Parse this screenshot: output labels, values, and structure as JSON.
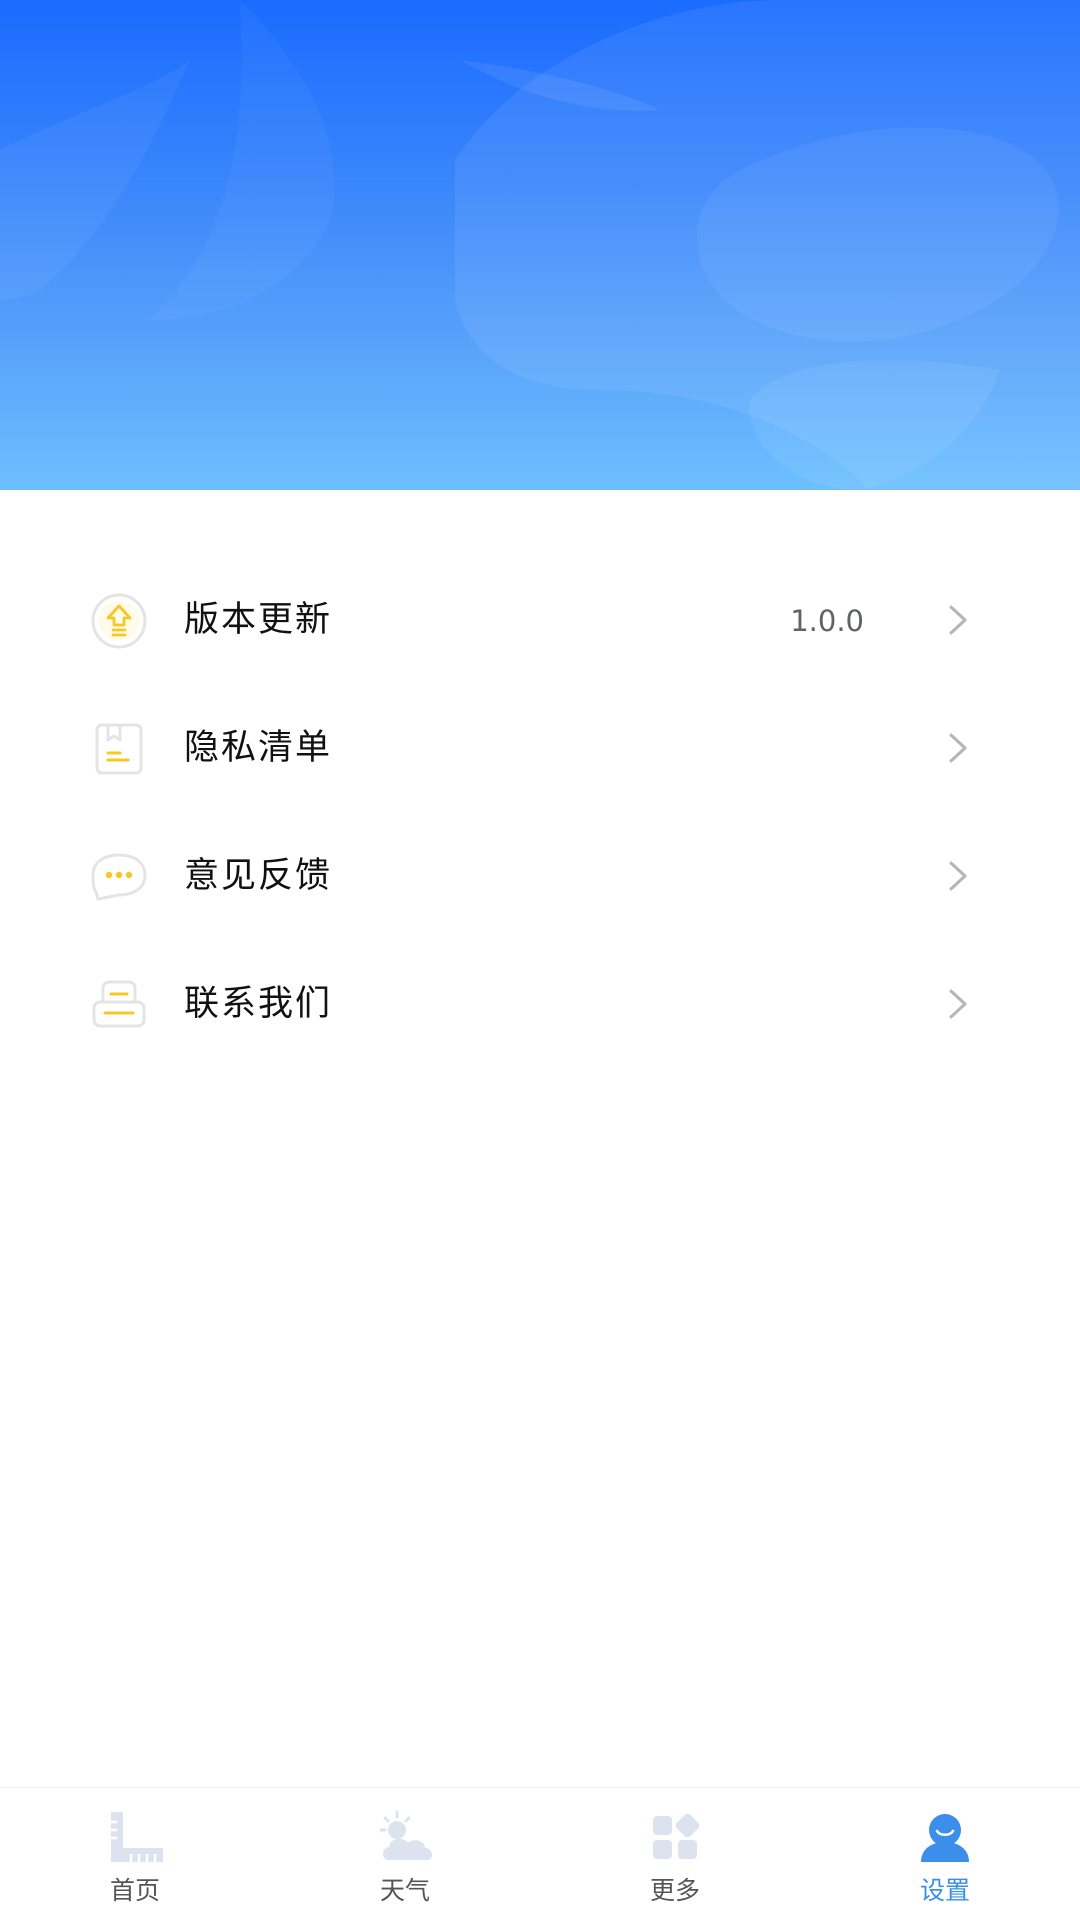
{
  "theme": {
    "accent": "#3b8eea",
    "icon_yellow": "#f5c823",
    "icon_outline": "#e4e4e4",
    "tab_inactive_icon": "#dde3ee"
  },
  "settings": {
    "items": [
      {
        "label": "版本更新",
        "value": "1.0.0",
        "icon": "upgrade-arrow-icon"
      },
      {
        "label": "隐私清单",
        "value": "",
        "icon": "privacy-list-icon"
      },
      {
        "label": "意见反馈",
        "value": "",
        "icon": "chat-bubble-icon"
      },
      {
        "label": "联系我们",
        "value": "",
        "icon": "contact-icon"
      }
    ]
  },
  "tabbar": {
    "active": "设置",
    "tabs": [
      {
        "label": "首页",
        "icon": "ruler-icon"
      },
      {
        "label": "天气",
        "icon": "weather-icon"
      },
      {
        "label": "更多",
        "icon": "grid-icon"
      },
      {
        "label": "设置",
        "icon": "user-icon"
      }
    ]
  }
}
